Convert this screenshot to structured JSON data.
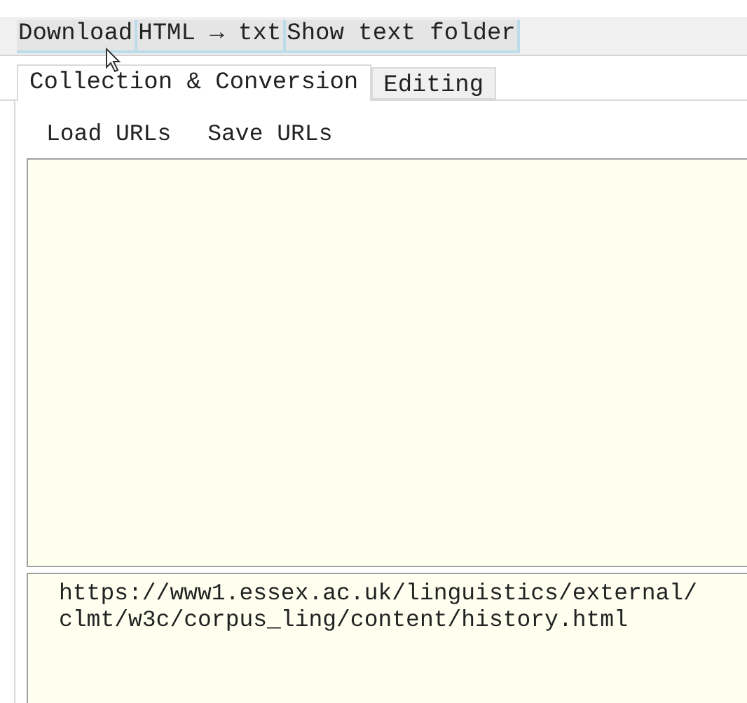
{
  "toolbar": [
    "Download",
    "HTML → txt",
    "Show text folder"
  ],
  "tabs": [
    {
      "label": "Collection & Conversion",
      "selected": true
    },
    {
      "label": "Editing",
      "selected": false
    }
  ],
  "actions": [
    "Load URLs",
    "Save URLs"
  ],
  "url_list": {
    "value": "https://www1.essex.ac.uk/linguistics/external/clmt/w3c/corpus_ling/content/history.html"
  }
}
